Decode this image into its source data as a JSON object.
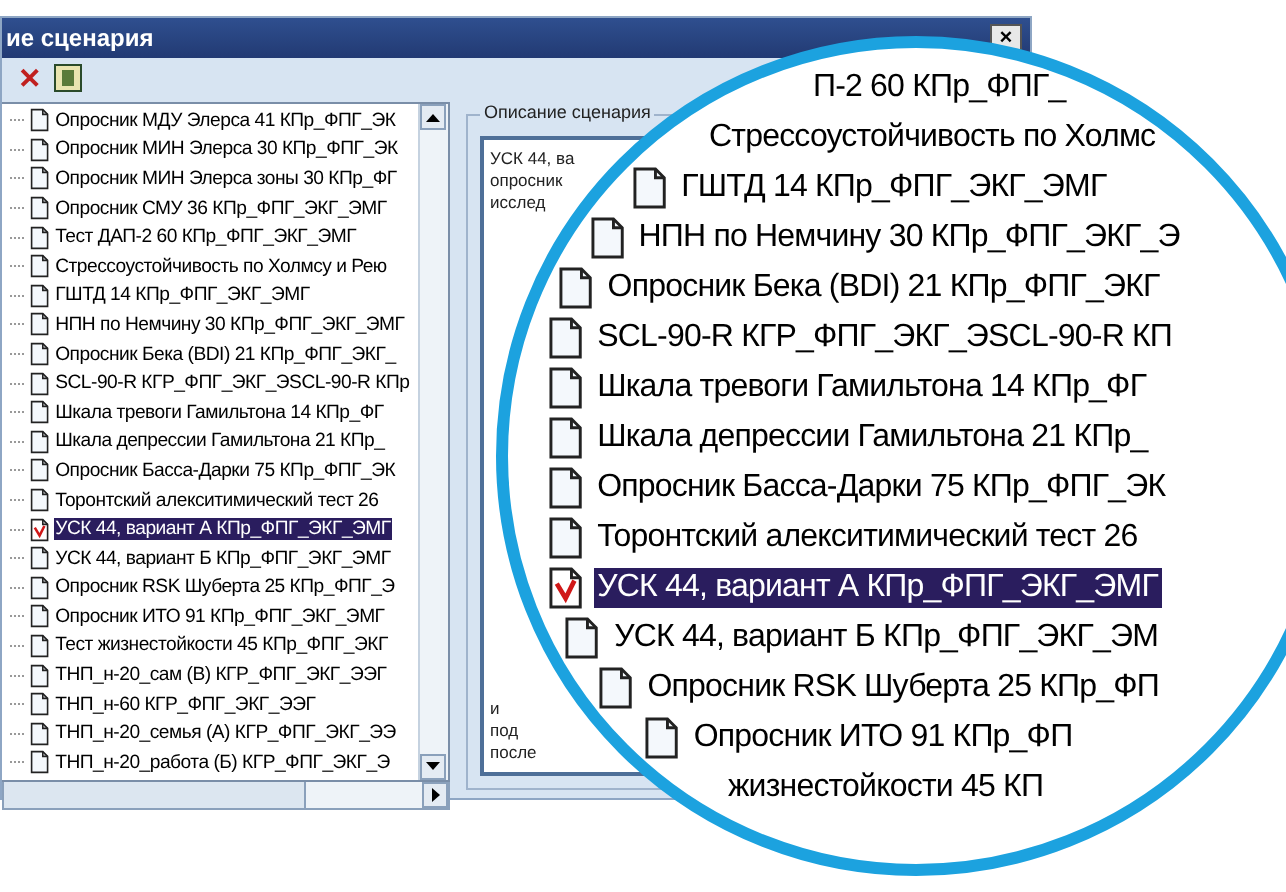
{
  "window": {
    "title": "ие сценария",
    "close": "×"
  },
  "toolbar": {
    "delete": "✕"
  },
  "scenario_list": {
    "items": [
      {
        "label": "Опросник МДУ Элерса 41 КПр_ФПГ_ЭК",
        "selected": false
      },
      {
        "label": "Опросник МИН Элерса 30 КПр_ФПГ_ЭК",
        "selected": false
      },
      {
        "label": "Опросник МИН Элерса зоны 30 КПр_ФГ",
        "selected": false
      },
      {
        "label": "Опросник СМУ 36 КПр_ФПГ_ЭКГ_ЭМГ",
        "selected": false
      },
      {
        "label": "Тест ДАП-2 60 КПр_ФПГ_ЭКГ_ЭМГ",
        "selected": false
      },
      {
        "label": "Стрессоустойчивость по Холмсу и Рею",
        "selected": false
      },
      {
        "label": "ГШТД 14 КПр_ФПГ_ЭКГ_ЭМГ",
        "selected": false
      },
      {
        "label": "НПН по Немчину 30 КПр_ФПГ_ЭКГ_ЭМГ",
        "selected": false
      },
      {
        "label": "Опросник Бека (BDI) 21 КПр_ФПГ_ЭКГ_",
        "selected": false
      },
      {
        "label": "SCL-90-R КГР_ФПГ_ЭКГ_ЭSCL-90-R КПр",
        "selected": false
      },
      {
        "label": "Шкала тревоги Гамильтона 14 КПр_ФГ",
        "selected": false
      },
      {
        "label": "Шкала депрессии Гамильтона 21 КПр_",
        "selected": false
      },
      {
        "label": "Опросник Басса-Дарки 75 КПр_ФПГ_ЭК",
        "selected": false
      },
      {
        "label": "Торонтский алекситимический тест 26",
        "selected": false
      },
      {
        "label": "УСК 44, вариант А КПр_ФПГ_ЭКГ_ЭМГ",
        "selected": true
      },
      {
        "label": "УСК 44, вариант Б КПр_ФПГ_ЭКГ_ЭМГ",
        "selected": false
      },
      {
        "label": "Опросник RSK Шуберта 25 КПр_ФПГ_Э",
        "selected": false
      },
      {
        "label": "Опросник ИТО 91 КПр_ФПГ_ЭКГ_ЭМГ",
        "selected": false
      },
      {
        "label": "Тест жизнестойкости 45 КПр_ФПГ_ЭКГ",
        "selected": false
      },
      {
        "label": "ТНП_н-20_сам (В) КГР_ФПГ_ЭКГ_ЭЭГ",
        "selected": false
      },
      {
        "label": "ТНП_н-60 КГР_ФПГ_ЭКГ_ЭЭГ",
        "selected": false
      },
      {
        "label": "ТНП_н-20_семья (А) КГР_ФПГ_ЭКГ_ЭЭ",
        "selected": false
      },
      {
        "label": "ТНП_н-20_работа (Б) КГР_ФПГ_ЭКГ_Э",
        "selected": false
      }
    ]
  },
  "description": {
    "legend": "Описание сценария",
    "top_lines": [
      "УСК 44, ва",
      "опросник",
      "исслед"
    ],
    "bottom_lines": [
      "и",
      "под",
      "после"
    ]
  },
  "magnifier": {
    "rows": [
      {
        "label": "П-2 60 КПр_ФПГ_",
        "selected": false
      },
      {
        "label": "Стрессоустойчивость по Холмс",
        "selected": false
      },
      {
        "label": "ГШТД 14 КПр_ФПГ_ЭКГ_ЭМГ",
        "selected": false
      },
      {
        "label": "НПН по Немчину 30 КПр_ФПГ_ЭКГ_Э",
        "selected": false
      },
      {
        "label": "Опросник Бека (BDI) 21 КПр_ФПГ_ЭКГ",
        "selected": false
      },
      {
        "label": "SCL-90-R КГР_ФПГ_ЭКГ_ЭSCL-90-R КП",
        "selected": false
      },
      {
        "label": "Шкала тревоги Гамильтона 14 КПр_ФГ",
        "selected": false
      },
      {
        "label": "Шкала депрессии Гамильтона 21 КПр_",
        "selected": false
      },
      {
        "label": "Опросник Басса-Дарки 75 КПр_ФПГ_ЭК",
        "selected": false
      },
      {
        "label": "Торонтский алекситимический тест 26",
        "selected": false
      },
      {
        "label": "УСК 44, вариант А КПр_ФПГ_ЭКГ_ЭМГ",
        "selected": true
      },
      {
        "label": "УСК 44, вариант Б КПр_ФПГ_ЭКГ_ЭМ",
        "selected": false
      },
      {
        "label": "Опросник RSK Шуберта 25 КПр_ФП",
        "selected": false
      },
      {
        "label": "Опросник ИТО 91 КПр_ФП",
        "selected": false
      },
      {
        "label": "жизнестойкости 45 КП",
        "selected": false
      }
    ]
  }
}
